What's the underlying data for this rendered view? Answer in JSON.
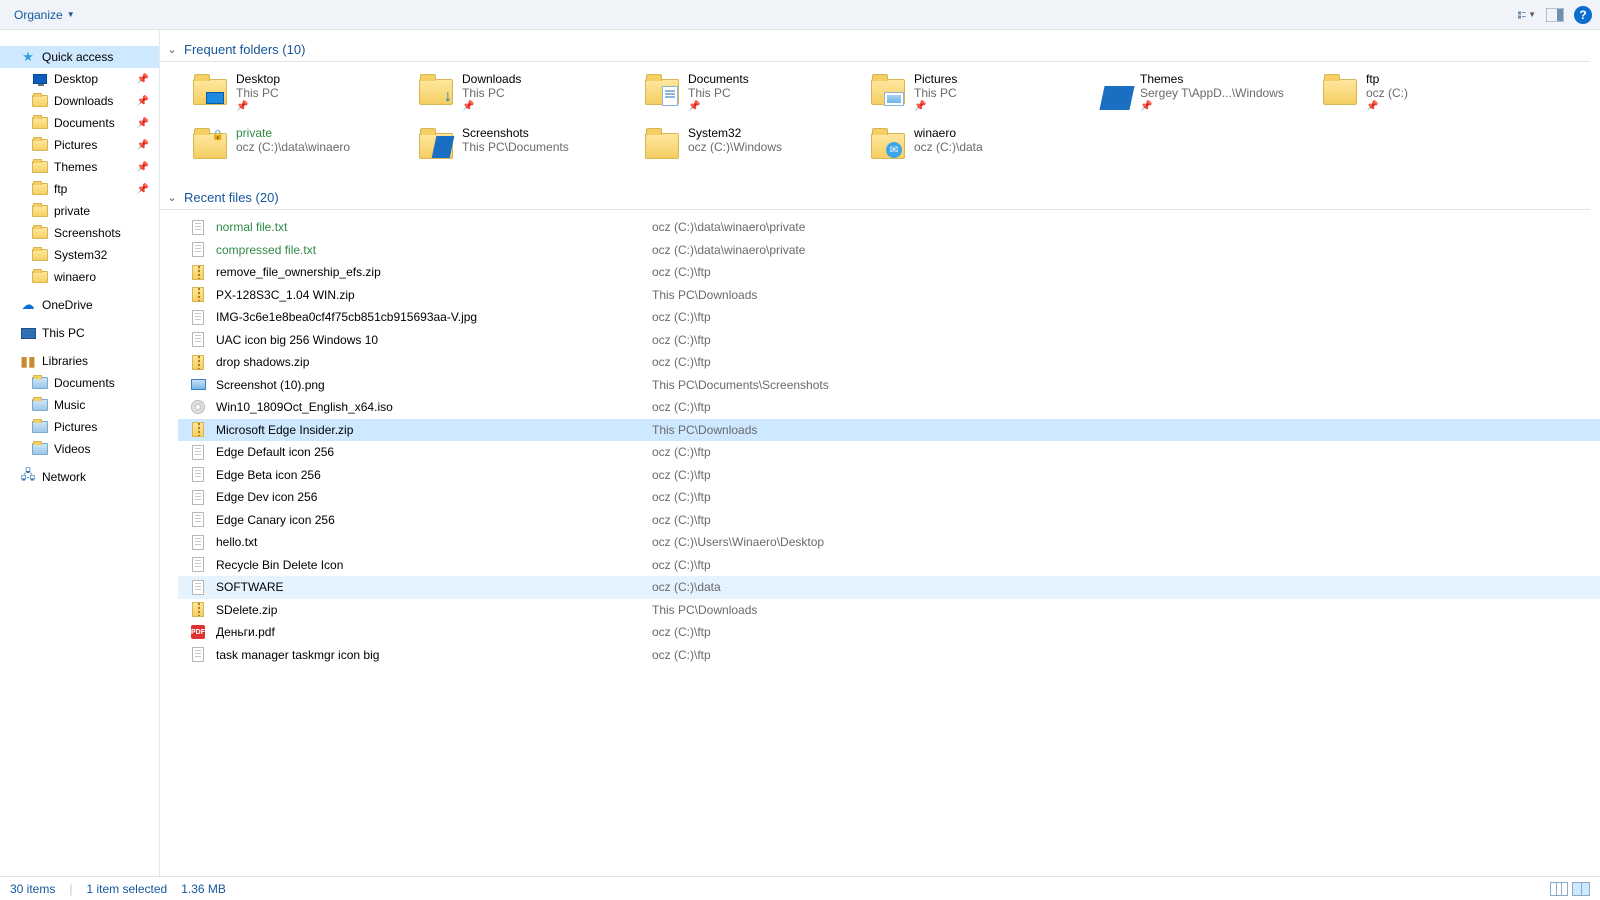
{
  "toolbar": {
    "organize": "Organize"
  },
  "sidebar": {
    "quickAccess": "Quick access",
    "qa": [
      {
        "label": "Desktop",
        "icon": "monitor",
        "pin": true
      },
      {
        "label": "Downloads",
        "icon": "dl",
        "pin": true
      },
      {
        "label": "Documents",
        "icon": "doc",
        "pin": true
      },
      {
        "label": "Pictures",
        "icon": "pic",
        "pin": true
      },
      {
        "label": "Themes",
        "icon": "folder",
        "pin": true
      },
      {
        "label": "ftp",
        "icon": "folder",
        "pin": true
      },
      {
        "label": "private",
        "icon": "folder",
        "pin": false
      },
      {
        "label": "Screenshots",
        "icon": "folder",
        "pin": false
      },
      {
        "label": "System32",
        "icon": "folder",
        "pin": false
      },
      {
        "label": "winaero",
        "icon": "folder",
        "pin": false
      }
    ],
    "oneDrive": "OneDrive",
    "thisPC": "This PC",
    "libraries": "Libraries",
    "libs": [
      "Documents",
      "Music",
      "Pictures",
      "Videos"
    ],
    "network": "Network"
  },
  "groups": {
    "frequent": {
      "title": "Frequent folders (10)"
    },
    "recent": {
      "title": "Recent files (20)"
    }
  },
  "frequent": [
    {
      "name": "Desktop",
      "sub": "This PC",
      "icon": "desktop",
      "pin": true
    },
    {
      "name": "Downloads",
      "sub": "This PC",
      "icon": "downloads",
      "pin": true
    },
    {
      "name": "Documents",
      "sub": "This PC",
      "icon": "documents",
      "pin": true
    },
    {
      "name": "Pictures",
      "sub": "This PC",
      "icon": "pictures",
      "pin": true
    },
    {
      "name": "Themes",
      "sub": "Sergey T\\AppD...\\Windows",
      "icon": "themes",
      "pin": true
    },
    {
      "name": "ftp",
      "sub": "ocz (C:)",
      "icon": "folder",
      "pin": true
    },
    {
      "name": "private",
      "sub": "ocz (C:)\\data\\winaero",
      "icon": "private",
      "pin": false,
      "green": true
    },
    {
      "name": "Screenshots",
      "sub": "This PC\\Documents",
      "icon": "screenshots",
      "pin": false
    },
    {
      "name": "System32",
      "sub": "ocz (C:)\\Windows",
      "icon": "folder",
      "pin": false
    },
    {
      "name": "winaero",
      "sub": "ocz (C:)\\data",
      "icon": "winaero",
      "pin": false
    }
  ],
  "recent": [
    {
      "name": "normal file.txt",
      "path": "ocz (C:)\\data\\winaero\\private",
      "icon": "doc",
      "green": true
    },
    {
      "name": "compressed file.txt",
      "path": "ocz (C:)\\data\\winaero\\private",
      "icon": "doc",
      "green": true
    },
    {
      "name": "remove_file_ownership_efs.zip",
      "path": "ocz (C:)\\ftp",
      "icon": "zip"
    },
    {
      "name": "PX-128S3C_1.04 WIN.zip",
      "path": "This PC\\Downloads",
      "icon": "zip"
    },
    {
      "name": "IMG-3c6e1e8bea0cf4f75cb851cb915693aa-V.jpg",
      "path": "ocz (C:)\\ftp",
      "icon": "doc"
    },
    {
      "name": "UAC icon big 256 Windows 10",
      "path": "ocz (C:)\\ftp",
      "icon": "doc"
    },
    {
      "name": "drop shadows.zip",
      "path": "ocz (C:)\\ftp",
      "icon": "zip"
    },
    {
      "name": "Screenshot (10).png",
      "path": "This PC\\Documents\\Screenshots",
      "icon": "img"
    },
    {
      "name": "Win10_1809Oct_English_x64.iso",
      "path": "ocz (C:)\\ftp",
      "icon": "iso"
    },
    {
      "name": "Microsoft Edge Insider.zip",
      "path": "This PC\\Downloads",
      "icon": "zip",
      "selected": true
    },
    {
      "name": "Edge Default icon 256",
      "path": "ocz (C:)\\ftp",
      "icon": "doc"
    },
    {
      "name": "Edge Beta icon 256",
      "path": "ocz (C:)\\ftp",
      "icon": "doc"
    },
    {
      "name": "Edge Dev icon 256",
      "path": "ocz (C:)\\ftp",
      "icon": "doc"
    },
    {
      "name": "Edge Canary icon 256",
      "path": "ocz (C:)\\ftp",
      "icon": "doc"
    },
    {
      "name": "hello.txt",
      "path": "ocz (C:)\\Users\\Winaero\\Desktop",
      "icon": "doc"
    },
    {
      "name": "Recycle Bin Delete Icon",
      "path": "ocz (C:)\\ftp",
      "icon": "doc"
    },
    {
      "name": "SOFTWARE",
      "path": "ocz (C:)\\data",
      "icon": "doc",
      "hover": true
    },
    {
      "name": "SDelete.zip",
      "path": "This PC\\Downloads",
      "icon": "zip"
    },
    {
      "name": "Деньги.pdf",
      "path": "ocz (C:)\\ftp",
      "icon": "pdf"
    },
    {
      "name": "task manager taskmgr icon big",
      "path": "ocz (C:)\\ftp",
      "icon": "doc"
    }
  ],
  "status": {
    "items": "30 items",
    "selected": "1 item selected",
    "size": "1.36 MB"
  }
}
